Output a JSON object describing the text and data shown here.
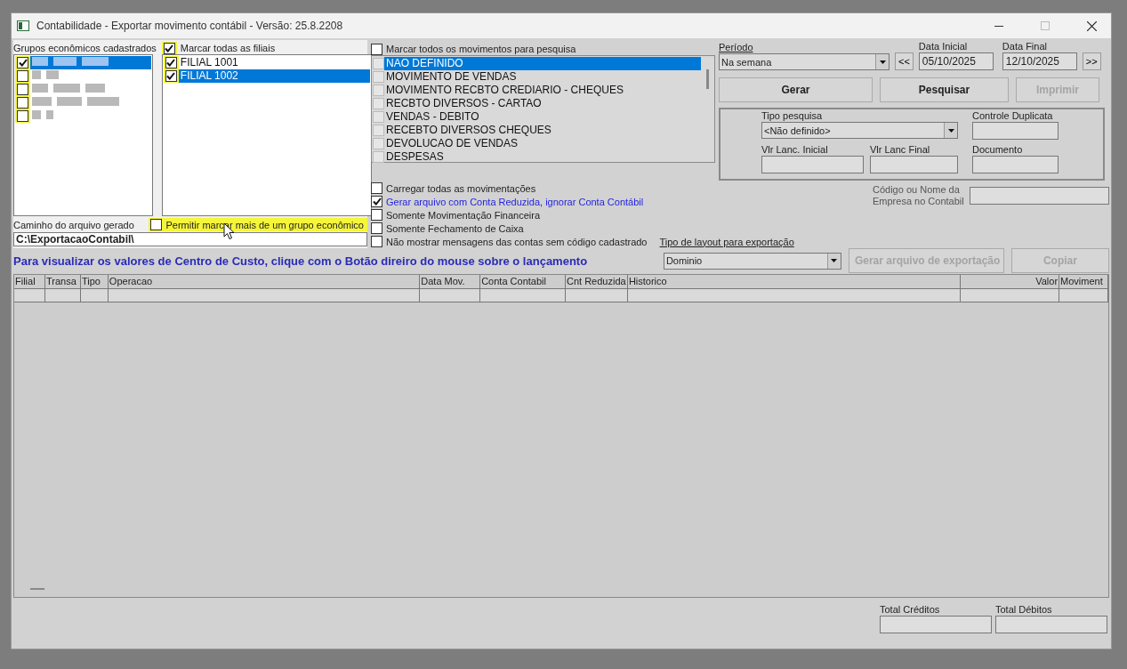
{
  "window": {
    "title": "Contabilidade - Exportar movimento contábil - Versão: 25.8.2208"
  },
  "groups": {
    "label": "Grupos econômicos cadastrados",
    "items": [
      {
        "checked": true,
        "selected": true
      },
      {
        "checked": false,
        "selected": false
      },
      {
        "checked": false,
        "selected": false
      },
      {
        "checked": false,
        "selected": false
      },
      {
        "checked": false,
        "selected": false
      }
    ]
  },
  "branches": {
    "select_all": {
      "label": "Marcar todas as filiais",
      "checked": true
    },
    "items": [
      {
        "label": "FILIAL 1001",
        "checked": true,
        "selected": false
      },
      {
        "label": "FILIAL 1002",
        "checked": true,
        "selected": true
      }
    ]
  },
  "path": {
    "label": "Caminho do arquivo gerado",
    "value": "C:\\ExportacaoContabil\\"
  },
  "allow_multiple_groups": {
    "label": "Permitir marcar mais de um grupo econômico",
    "checked": false
  },
  "movements": {
    "select_all": {
      "label": "Marcar todos os movimentos para pesquisa",
      "checked": false
    },
    "items": [
      {
        "label": "NAO DEFINIDO",
        "checked": false,
        "selected": true
      },
      {
        "label": "MOVIMENTO DE VENDAS",
        "checked": false,
        "selected": false
      },
      {
        "label": "MOVIMENTO RECBTO CREDIARIO - CHEQUES",
        "checked": false,
        "selected": false
      },
      {
        "label": "RECBTO DIVERSOS - CARTAO",
        "checked": false,
        "selected": false
      },
      {
        "label": "VENDAS - DEBITO",
        "checked": false,
        "selected": false
      },
      {
        "label": "RECEBTO DIVERSOS CHEQUES",
        "checked": false,
        "selected": false
      },
      {
        "label": "DEVOLUCAO DE VENDAS",
        "checked": false,
        "selected": false
      },
      {
        "label": "DESPESAS",
        "checked": false,
        "selected": false
      }
    ]
  },
  "options": [
    {
      "label": "Carregar todas as movimentações",
      "checked": false,
      "highlighted": false
    },
    {
      "label": "Gerar arquivo com Conta Reduzida, ignorar Conta Contábil",
      "checked": true,
      "highlighted": true
    },
    {
      "label": "Somente Movimentação Financeira",
      "checked": false,
      "highlighted": false
    },
    {
      "label": "Somente Fechamento de Caixa",
      "checked": false,
      "highlighted": false
    },
    {
      "label": "Não mostrar mensagens das contas sem código cadastrado",
      "checked": false,
      "highlighted": false
    }
  ],
  "period": {
    "label": "Período",
    "value": "Na semana",
    "prev": "<<",
    "next": ">>",
    "start_label": "Data Inicial",
    "start": "05/10/2025",
    "end_label": "Data Final",
    "end": "12/10/2025"
  },
  "actions": [
    {
      "label": "Gerar",
      "disabled": false
    },
    {
      "label": "Pesquisar",
      "disabled": false
    },
    {
      "label": "Imprimir",
      "disabled": true
    }
  ],
  "filters": {
    "search_type_label": "Tipo pesquisa",
    "search_type": "<Não definido>",
    "duplicate_label": "Controle Duplicata",
    "value_start_label": "Vlr Lanc. Inicial",
    "value_end_label": "Vlr Lanc Final",
    "document_label": "Documento"
  },
  "company_code_label": "Código ou Nome da Empresa no Contabil",
  "message": "Para visualizar os valores de Centro de Custo, clique com o Botão direiro do mouse sobre o lançamento",
  "layout": {
    "label": "Tipo de layout para exportação",
    "value": "Dominio"
  },
  "export_actions": [
    {
      "label": "Gerar arquivo de exportação",
      "disabled": true
    },
    {
      "label": "Copiar",
      "disabled": true
    }
  ],
  "table": {
    "columns": [
      "Filial",
      "Transa",
      "Tipo",
      "Operacao",
      "Data Mov.",
      "Conta Contabil",
      "Cnt Reduzida",
      "Historico",
      "Valor",
      "Moviment"
    ]
  },
  "totals": [
    {
      "label": "Total Créditos"
    },
    {
      "label": "Total Débitos"
    }
  ]
}
